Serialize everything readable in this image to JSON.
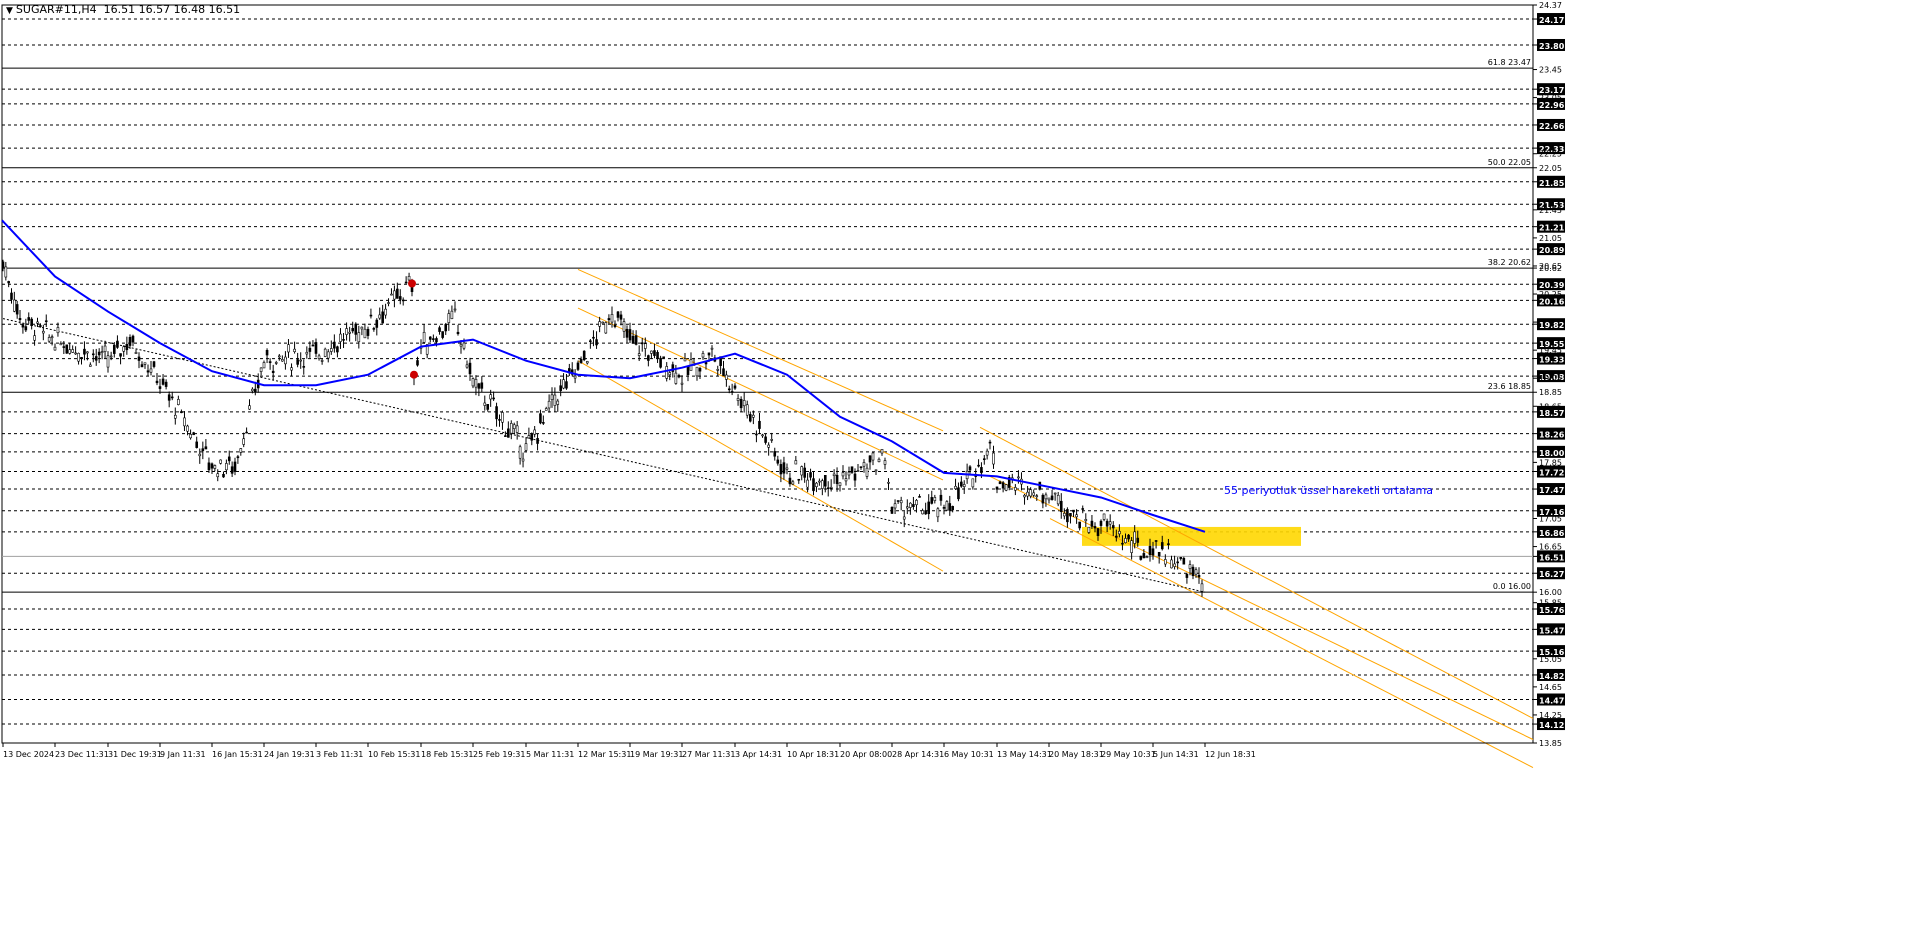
{
  "header": {
    "marker": "▼",
    "symbol": "SUGAR#11,H4",
    "ohlc": "16.51 16.57 16.48 16.51"
  },
  "colors": {
    "background": "#ffffff",
    "candle": "#000000",
    "ema": "#0000ff",
    "channel": "#ffa500",
    "zone": "#ffd700",
    "price_label_bg": "#000000",
    "price_label_text": "#ffffff",
    "grid_dashed": "#000000",
    "fib_line": "#000000",
    "annotation_text": "#0000ff",
    "pivot_marker": "#cc0000"
  },
  "chart_data": {
    "type": "candlestick",
    "timeframe": "H4",
    "ylim": [
      13.85,
      24.37
    ],
    "axis_ticks": [
      "24.37",
      "24.17",
      "23.80",
      "23.45",
      "23.17",
      "23.05",
      "22.96",
      "22.66",
      "22.33",
      "22.25",
      "22.05",
      "21.85",
      "21.53",
      "21.45",
      "21.21",
      "21.05",
      "20.89",
      "20.65",
      "20.62",
      "20.39",
      "20.25",
      "20.16",
      "19.85",
      "19.82",
      "19.55",
      "19.45",
      "19.33",
      "19.08",
      "19.05",
      "18.85",
      "18.65",
      "18.57",
      "18.26",
      "18.00",
      "17.85",
      "17.72",
      "17.47",
      "17.16",
      "17.05",
      "16.86",
      "16.65",
      "16.51",
      "16.27",
      "16.00",
      "15.85",
      "15.76",
      "15.47",
      "15.16",
      "15.05",
      "14.82",
      "14.65",
      "14.47",
      "14.25",
      "14.12",
      "13.85"
    ],
    "x_ticks": [
      "13 Dec 2024",
      "23 Dec 11:31",
      "31 Dec 19:31",
      "9 Jan 11:31",
      "16 Jan 15:31",
      "24 Jan 19:31",
      "3 Feb 11:31",
      "10 Feb 15:31",
      "18 Feb 15:31",
      "25 Feb 19:31",
      "5 Mar 11:31",
      "12 Mar 15:31",
      "19 Mar 19:31",
      "27 Mar 11:31",
      "3 Apr 14:31",
      "10 Apr 18:31",
      "20 Apr 08:00",
      "28 Apr 14:31",
      "6 May 10:31",
      "13 May 14:31",
      "20 May 18:31",
      "29 May 10:31",
      "5 Jun 14:31",
      "12 Jun 18:31"
    ],
    "horizontal_levels": [
      "24.17",
      "23.80",
      "23.17",
      "22.96",
      "22.66",
      "22.33",
      "21.85",
      "21.53",
      "21.21",
      "20.89",
      "20.39",
      "20.16",
      "19.82",
      "19.55",
      "19.33",
      "19.08",
      "18.57",
      "18.26",
      "18.00",
      "17.72",
      "17.47",
      "17.16",
      "16.86",
      "16.27",
      "15.76",
      "15.47",
      "15.16",
      "14.82",
      "14.47",
      "14.12"
    ],
    "fibonacci": [
      {
        "label": "61.8 23.47",
        "value": 23.47
      },
      {
        "label": "50.0 22.05",
        "value": 22.05
      },
      {
        "label": "38.2 20.62",
        "value": 20.62
      },
      {
        "label": "23.6 18.85",
        "value": 18.85
      },
      {
        "label": "0.0 16.00",
        "value": 16.0
      }
    ],
    "current_price": 16.51,
    "current_price_label": "16.51",
    "annotation": "55 periyotluk üssel hareketli ortalama",
    "supply_zone": {
      "top": 16.93,
      "bottom": 16.66,
      "from": "20 May 18:31",
      "to": "12 Jun 18:31"
    },
    "price_path": [
      {
        "t": "13 Dec 2024",
        "v": 20.7
      },
      {
        "t": "16 Dec",
        "v": 19.9
      },
      {
        "t": "23 Dec 11:31",
        "v": 19.6
      },
      {
        "t": "31 Dec 19:31",
        "v": 19.3
      },
      {
        "t": "5 Jan",
        "v": 19.6
      },
      {
        "t": "9 Jan 11:31",
        "v": 19.0
      },
      {
        "t": "16 Jan 15:31",
        "v": 17.8
      },
      {
        "t": "19 Jan",
        "v": 17.8
      },
      {
        "t": "24 Jan 19:31",
        "v": 19.3
      },
      {
        "t": "3 Feb 11:31",
        "v": 19.4
      },
      {
        "t": "10 Feb 15:31",
        "v": 19.8
      },
      {
        "t": "13 Feb",
        "v": 20.4
      },
      {
        "t": "14 Feb",
        "v": 19.1
      },
      {
        "t": "18 Feb 15:31",
        "v": 19.5
      },
      {
        "t": "22 Feb",
        "v": 19.9
      },
      {
        "t": "25 Feb 19:31",
        "v": 19.0
      },
      {
        "t": "5 Mar 11:31",
        "v": 18.0
      },
      {
        "t": "9 Mar",
        "v": 18.7
      },
      {
        "t": "12 Mar 15:31",
        "v": 19.2
      },
      {
        "t": "15 Mar",
        "v": 20.0
      },
      {
        "t": "19 Mar 19:31",
        "v": 19.6
      },
      {
        "t": "27 Mar 11:31",
        "v": 19.1
      },
      {
        "t": "31 Mar",
        "v": 19.4
      },
      {
        "t": "3 Apr 14:31",
        "v": 18.9
      },
      {
        "t": "10 Apr 18:31",
        "v": 17.7
      },
      {
        "t": "20 Apr 08:00",
        "v": 17.6
      },
      {
        "t": "24 Apr",
        "v": 17.9
      },
      {
        "t": "28 Apr 14:31",
        "v": 17.2
      },
      {
        "t": "6 May 10:31",
        "v": 17.2
      },
      {
        "t": "8 May",
        "v": 17.6
      },
      {
        "t": "11 May",
        "v": 18.1
      },
      {
        "t": "13 May 14:31",
        "v": 17.6
      },
      {
        "t": "20 May 18:31",
        "v": 17.4
      },
      {
        "t": "23 May",
        "v": 16.9
      },
      {
        "t": "29 May 10:31",
        "v": 17.0
      },
      {
        "t": "3 Jun",
        "v": 16.5
      },
      {
        "t": "5 Jun 14:31",
        "v": 16.7
      },
      {
        "t": "10 Jun",
        "v": 16.3
      },
      {
        "t": "12 Jun 18:31",
        "v": 16.1
      }
    ],
    "ema55": [
      {
        "t": "12 Dec",
        "v": 21.3
      },
      {
        "t": "23 Dec 11:31",
        "v": 20.5
      },
      {
        "t": "31 Dec 19:31",
        "v": 20.0
      },
      {
        "t": "9 Jan 11:31",
        "v": 19.55
      },
      {
        "t": "16 Jan 15:31",
        "v": 19.15
      },
      {
        "t": "24 Jan 19:31",
        "v": 18.95
      },
      {
        "t": "3 Feb 11:31",
        "v": 18.95
      },
      {
        "t": "10 Feb 15:31",
        "v": 19.1
      },
      {
        "t": "18 Feb 15:31",
        "v": 19.5
      },
      {
        "t": "25 Feb 19:31",
        "v": 19.6
      },
      {
        "t": "5 Mar 11:31",
        "v": 19.3
      },
      {
        "t": "12 Mar 15:31",
        "v": 19.1
      },
      {
        "t": "19 Mar 19:31",
        "v": 19.05
      },
      {
        "t": "27 Mar 11:31",
        "v": 19.2
      },
      {
        "t": "3 Apr 14:31",
        "v": 19.4
      },
      {
        "t": "10 Apr 18:31",
        "v": 19.1
      },
      {
        "t": "20 Apr 08:00",
        "v": 18.5
      },
      {
        "t": "28 Apr 14:31",
        "v": 18.15
      },
      {
        "t": "6 May 10:31",
        "v": 17.7
      },
      {
        "t": "13 May 14:31",
        "v": 17.65
      },
      {
        "t": "20 May 18:31",
        "v": 17.5
      },
      {
        "t": "29 May 10:31",
        "v": 17.35
      },
      {
        "t": "5 Jun 14:31",
        "v": 17.1
      },
      {
        "t": "12 Jun 18:31",
        "v": 16.86
      }
    ],
    "trendlines": [
      {
        "name": "Channel 1 upper",
        "from": {
          "t": "12 Mar 15:31",
          "v": 20.6
        },
        "to": {
          "t": "27 Apr",
          "v": 18.3
        }
      },
      {
        "name": "Channel 1 middle",
        "from": {
          "t": "12 Mar 15:31",
          "v": 20.05
        },
        "to": {
          "t": "27 Apr",
          "v": 17.6
        }
      },
      {
        "name": "Channel 1 lower",
        "from": {
          "t": "12 Mar 15:31",
          "v": 19.3
        },
        "to": {
          "t": "2 May",
          "v": 16.3
        }
      },
      {
        "name": "Channel 2 upper",
        "from": {
          "t": "10 May",
          "v": 18.35
        },
        "to": {
          "t": "right edge",
          "v": 14.2
        }
      },
      {
        "name": "Channel 2 middle",
        "from": {
          "t": "12 May",
          "v": 17.65
        },
        "to": {
          "t": "right edge",
          "v": 13.9
        }
      },
      {
        "name": "Channel 2 lower",
        "from": {
          "t": "20 May",
          "v": 17.05
        },
        "to": {
          "t": "right edge",
          "v": 13.5
        }
      },
      {
        "name": "Dotted support",
        "from": {
          "t": "13 Dec 2024",
          "v": 19.9
        },
        "to": {
          "t": "12 Jun 18:31",
          "v": 16.0
        }
      }
    ],
    "pivot_markers": [
      {
        "t": "13 Feb",
        "v": 20.4
      },
      {
        "t": "14 Feb",
        "v": 19.1
      }
    ],
    "grid": false,
    "legend": "none"
  }
}
